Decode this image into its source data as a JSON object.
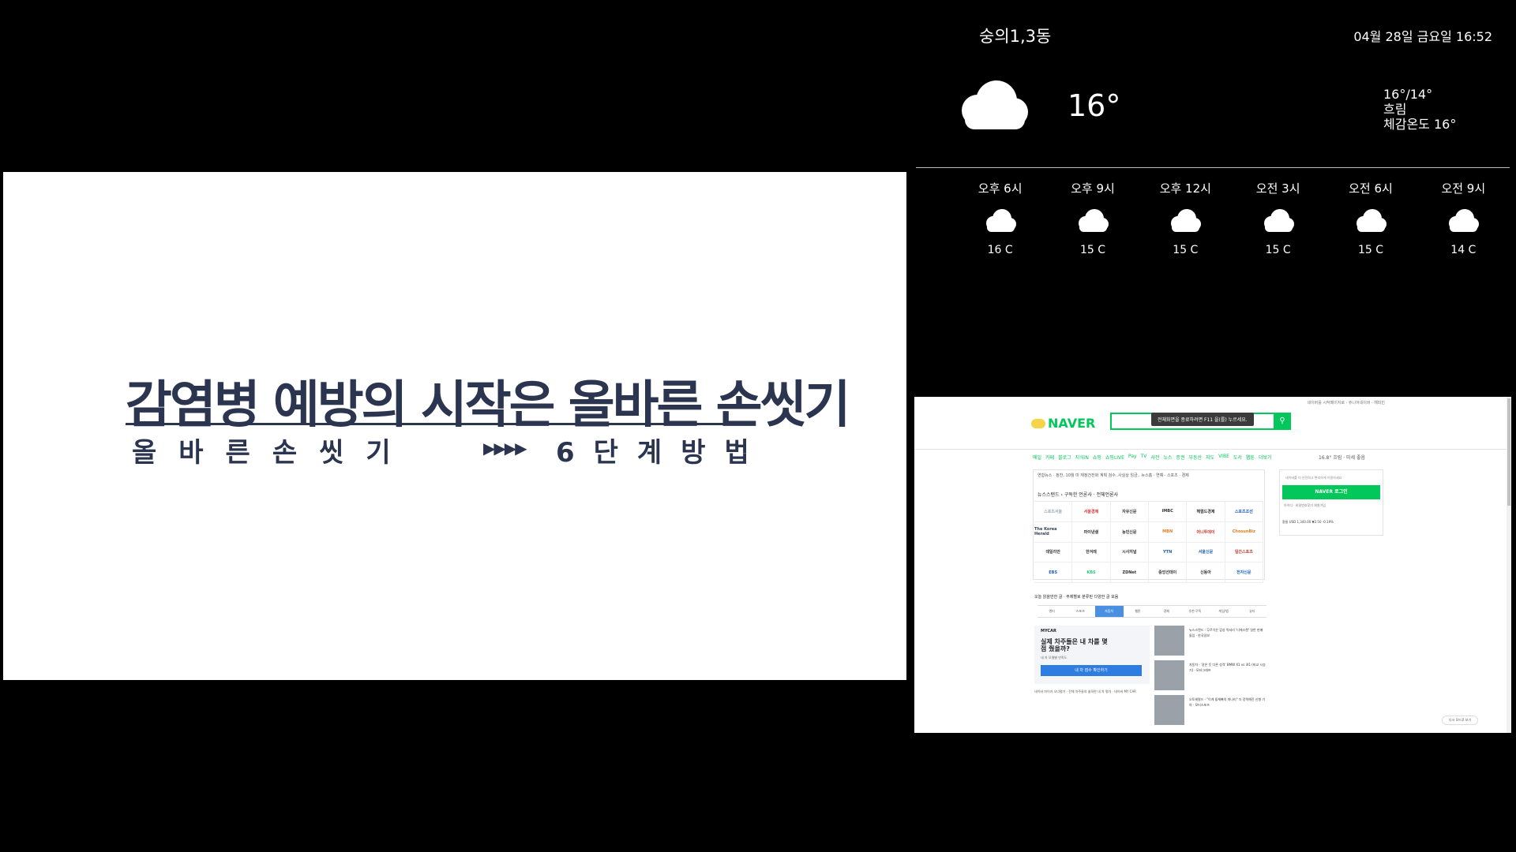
{
  "video": {
    "title": "감염병 예방의 시작은 올바른 손씻기",
    "subtitle_left": "올바른손씻기",
    "arrows": "▶▶▶▶",
    "subtitle_right": "6단계방법"
  },
  "weather": {
    "location": "숭의1,3동",
    "datetime": "04월 28일 금요일 16:52",
    "current": {
      "icon": "cloud-icon",
      "temp": "16°",
      "high_low": "16°/14°",
      "condition": "흐림",
      "feels_like": "체감온도 16°"
    },
    "forecast": [
      {
        "time": "오후 6시",
        "icon": "cloud-icon",
        "temp": "16 C"
      },
      {
        "time": "오후 9시",
        "icon": "cloud-icon",
        "temp": "15 C"
      },
      {
        "time": "오후 12시",
        "icon": "cloud-icon",
        "temp": "15 C"
      },
      {
        "time": "오전 3시",
        "icon": "cloud-icon",
        "temp": "15 C"
      },
      {
        "time": "오전 6시",
        "icon": "cloud-icon",
        "temp": "15 C"
      },
      {
        "time": "오전 9시",
        "icon": "cloud-icon",
        "temp": "14 C"
      }
    ]
  },
  "browser": {
    "top_links": "네이버를 시작페이지로 · 쥬니어네이버 · 해피빈",
    "logo_text": "NAVER",
    "search_tooltip": "전체화면을 종료하려면 F11 을(를) 누르세요.",
    "search_icon": "search-icon",
    "service_nav": [
      "메일",
      "카페",
      "블로그",
      "지식iN",
      "쇼핑",
      "쇼핑LIVE",
      "Pay",
      "TV",
      "사전",
      "뉴스",
      "증권",
      "부동산",
      "지도",
      "VIBE",
      "도서",
      "웹툰",
      "더보기"
    ],
    "nav_weather": "16.8° 흐림 · 미세 좋음",
    "news_ticker": "연합뉴스 · 정찬, 10월 미 재정건전화 계획 검수..사실상 임금..   뉴스홈 · 연예 · 스포츠 · 경제",
    "newsstand_title": "뉴스스탠드 › 구독한 언론사 · 전체언론사",
    "press_cells": [
      "스포츠서울",
      "서울경제",
      "자유신문",
      "iMBC",
      "헤럴드경제",
      "스포츠조선",
      "The Korea Herald",
      "파이낸셜",
      "농민신문",
      "MBN",
      "머니투데이",
      "ChosunBiz",
      "데일리안",
      "한겨레",
      "시사저널",
      "YTN",
      "서울신문",
      "일간스포츠",
      "EBS",
      "KBS",
      "ZDNet",
      "중앙선데이",
      "신동아",
      "전자신문"
    ],
    "login_text": "네이버를 더 안전하고 편리하게 이용하세요",
    "login_button": "NAVER 로그인",
    "login_links": "아이디 · 비밀번호찾기     회원가입",
    "exchange": "환율  USD 1,340.00  ▼2.50 -0.19%",
    "subscribe_label": "오늘 읽을만한 글 · 주제별로 분류된 다양한 글 모음",
    "topic_tabs": [
      "엔터",
      "스포츠",
      "자동차",
      "웹툰",
      "경제",
      "추천·구독",
      "게임/앱",
      "뷰티"
    ],
    "active_topic_index": 2,
    "mycar": {
      "brand": "MYCAR",
      "heading": "실제 차주들은 내 차를 몇점 줬을까?",
      "sub": "내 차 모델별 만족도",
      "button": "내 차 점수 확인하기",
      "footer": "네이버 마이카 오너평가 · 전체 차주들의 솔직한 내 차 평가 · 네이버 MY CAR"
    },
    "car_news": [
      "뉴스스탠드 · 무르익은 감성 럭셔리 '디에스랜' 일반 판매 돌입 · 한국일보",
      "자동차 · '같은 듯 다른 성격' BMW X1 vs iX1 (비교 시승기) · 모터그래프",
      "오토헤럴드 · \"이게 돌체빠의 마나리\" 더 강력해진 신형 기아 · 모터스포츠"
    ],
    "floating_button": "다크 모드로 보기"
  },
  "colors": {
    "naver_green": "#03c75a",
    "video_text": "#2c3550",
    "background": "#000000"
  }
}
